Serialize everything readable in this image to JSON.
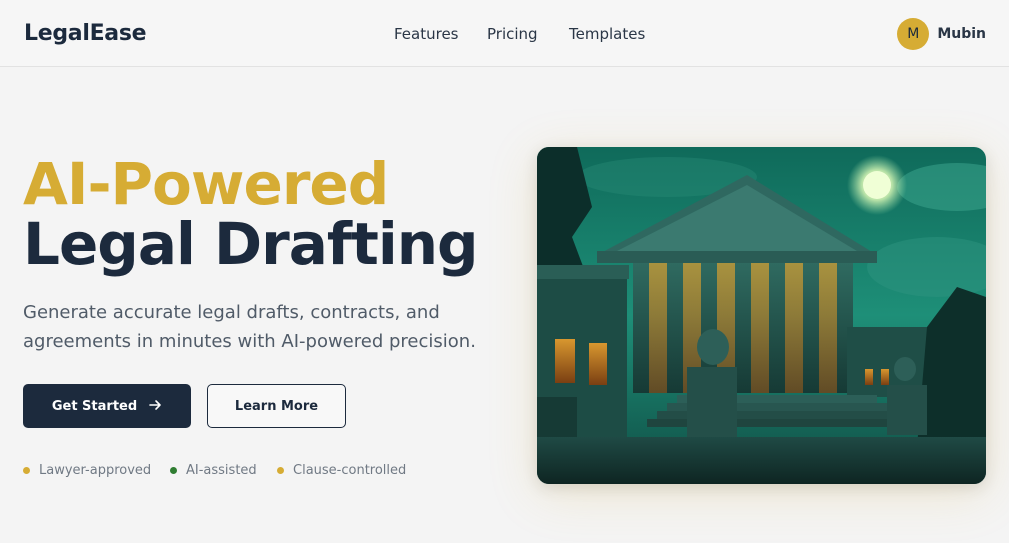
{
  "header": {
    "brand": "LegalEase",
    "nav": [
      {
        "label": "Features"
      },
      {
        "label": "Pricing"
      },
      {
        "label": "Templates"
      }
    ],
    "user": {
      "initial": "M",
      "name": "Mubin"
    }
  },
  "hero": {
    "title_line1": "AI-Powered",
    "title_line2": "Legal Drafting",
    "subtitle": "Generate accurate legal drafts, contracts, and agreements in minutes with AI-powered precision.",
    "primary_button": "Get Started",
    "secondary_button": "Learn More",
    "features": [
      {
        "label": "Lawyer-approved",
        "color": "#d6ac34"
      },
      {
        "label": "AI-assisted",
        "color": "#2f7d32"
      },
      {
        "label": "Clause-controlled",
        "color": "#d6ac34"
      }
    ]
  },
  "colors": {
    "accent": "#d6ac34",
    "navy": "#1c2a3d",
    "background": "#f4f4f4"
  },
  "icons": {
    "arrow": "arrow-right-icon"
  }
}
